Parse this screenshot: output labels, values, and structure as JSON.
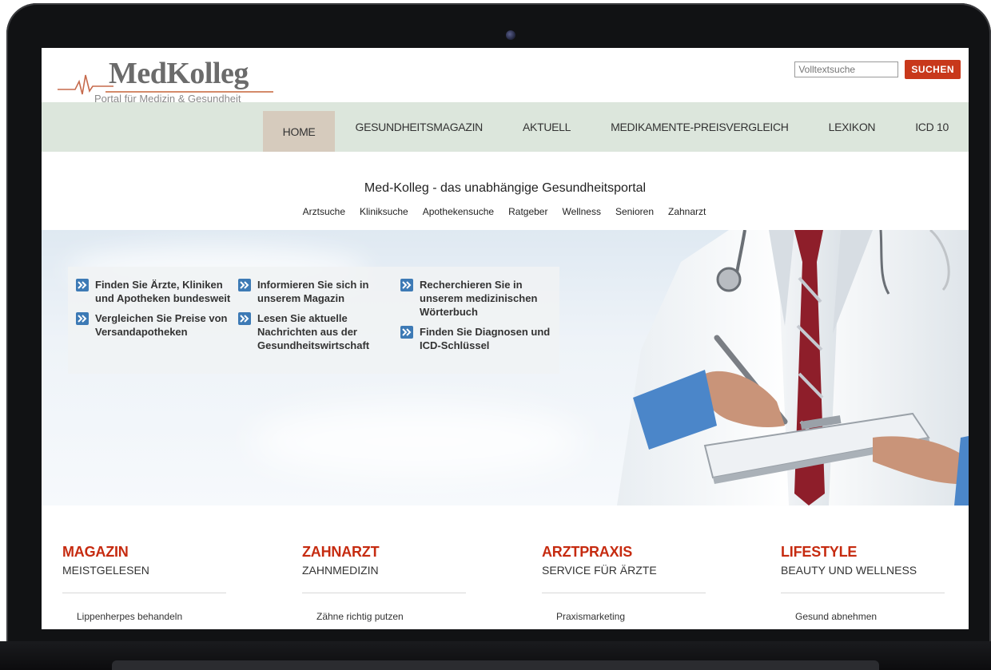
{
  "logo": {
    "title": "MedKolleg",
    "subtitle": "Portal für Medizin & Gesundheit"
  },
  "search": {
    "placeholder": "Volltextsuche",
    "button_label": "SUCHEN"
  },
  "mainnav": {
    "items": [
      "HOME",
      "GESUNDHEITSMAGAZIN",
      "AKTUELL",
      "MEDIKAMENTE-PREISVERGLEICH",
      "LEXIKON",
      "ICD 10"
    ],
    "active": "HOME"
  },
  "tagline": "Med-Kolleg - das unabhängige Gesundheitsportal",
  "subnav": {
    "items": [
      "Arztsuche",
      "Kliniksuche",
      "Apothekensuche",
      "Ratgeber",
      "Wellness",
      "Senioren",
      "Zahnarzt"
    ]
  },
  "hero": {
    "col1": [
      "Finden Sie Ärzte, Kliniken und Apotheken bundesweit",
      "Vergleichen Sie Preise von Versandapotheken"
    ],
    "col2": [
      "Informieren Sie sich in unserem Magazin",
      "Lesen Sie aktuelle Nachrichten aus der Gesundheitswirtschaft"
    ],
    "col3": [
      "Recherchieren Sie in unserem medizinischen Wörterbuch",
      "Finden Sie Diagnosen und ICD-Schlüssel"
    ],
    "icon": "double-arrow-icon"
  },
  "columns": [
    {
      "title": "MAGAZIN",
      "subtitle": "MEISTGELESEN",
      "link": "Lippenherpes behandeln"
    },
    {
      "title": "ZAHNARZT",
      "subtitle": "ZAHNMEDIZIN",
      "link": "Zähne richtig putzen"
    },
    {
      "title": "ARZTPRAXIS",
      "subtitle": "SERVICE FÜR ÄRZTE",
      "link": "Praxismarketing"
    },
    {
      "title": "LIFESTYLE",
      "subtitle": "BEAUTY UND WELLNESS",
      "link": "Gesund abnehmen"
    }
  ],
  "colors": {
    "accent_red": "#c62b10",
    "nav_bg": "#dce6dc",
    "nav_active": "#d6cbbd",
    "arrow_blue": "#3d7ab5"
  }
}
